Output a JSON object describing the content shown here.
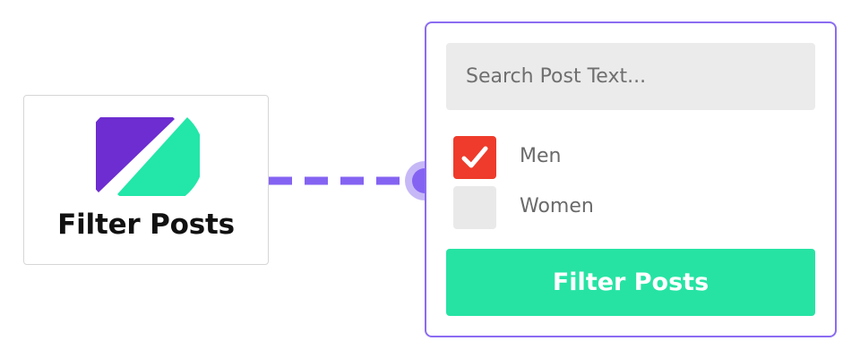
{
  "feature_card": {
    "title": "Filter Posts",
    "logo_icon": "half-circles-logo-icon"
  },
  "connector": {
    "icon": "connection-node-icon",
    "color": "#8463f2"
  },
  "form": {
    "search": {
      "placeholder": "Search Post Text...",
      "value": ""
    },
    "options": [
      {
        "label": "Men",
        "checked": true
      },
      {
        "label": "Women",
        "checked": false
      }
    ],
    "submit_label": "Filter Posts"
  },
  "colors": {
    "panel_border": "#8b6cf2",
    "checkbox_checked": "#ee3b2b",
    "checkbox_unchecked": "#e9e9e9",
    "button": "#26e3a4",
    "logo_purple": "#6d2dd0",
    "logo_mint": "#22e7a8"
  }
}
